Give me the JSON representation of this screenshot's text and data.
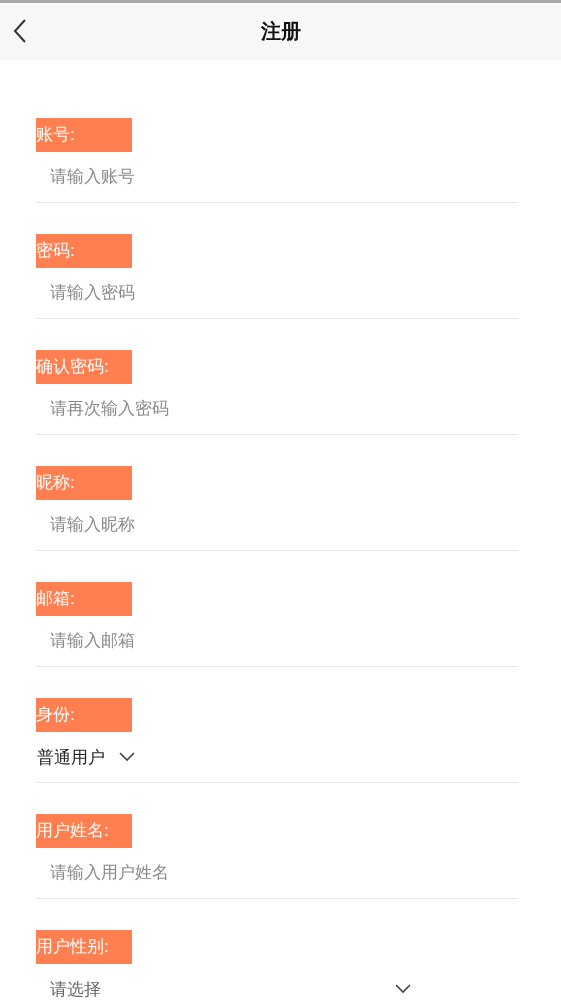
{
  "header": {
    "title": "注册"
  },
  "fields": [
    {
      "kind": "input",
      "label": "账号:",
      "placeholder": "请输入账号"
    },
    {
      "kind": "input",
      "label": "密码:",
      "placeholder": "请输入密码"
    },
    {
      "kind": "input",
      "label": "确认密码:",
      "placeholder": "请再次输入密码"
    },
    {
      "kind": "input",
      "label": "昵称:",
      "placeholder": "请输入昵称"
    },
    {
      "kind": "input",
      "label": "邮箱:",
      "placeholder": "请输入邮箱"
    },
    {
      "kind": "select",
      "label": "身份:",
      "value": "普通用户"
    },
    {
      "kind": "input",
      "label": "用户姓名:",
      "placeholder": "请输入用户姓名"
    },
    {
      "kind": "select",
      "label": "用户性别:",
      "placeholder": "请选择"
    }
  ]
}
